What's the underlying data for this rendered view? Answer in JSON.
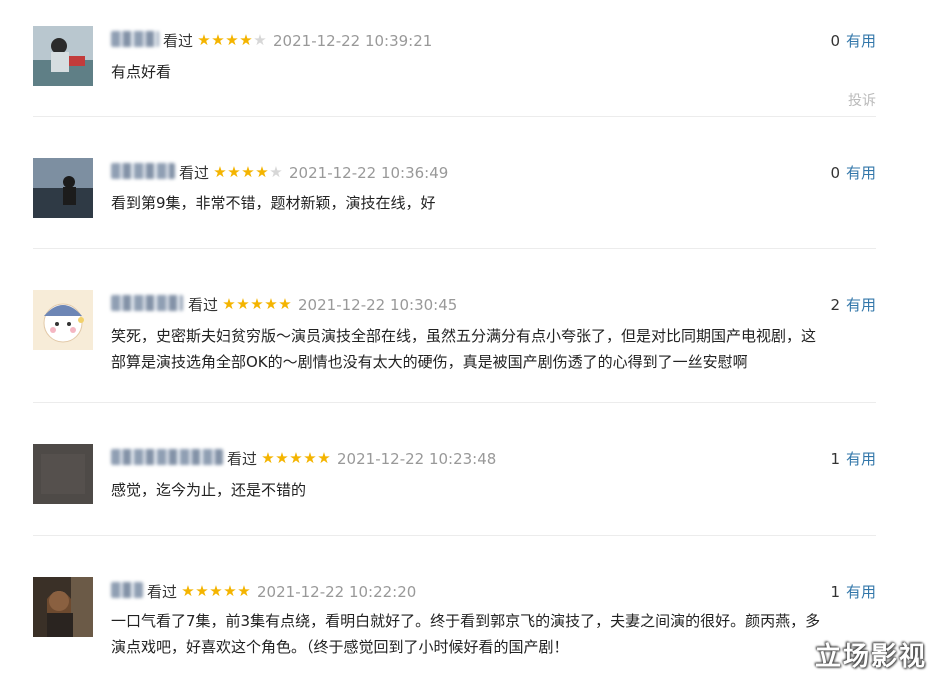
{
  "labels": {
    "watched": "看过",
    "useful": "有用",
    "report": "投诉"
  },
  "colors": {
    "star": "#f4b400",
    "useful_link": "#3377aa",
    "time": "#999999"
  },
  "comments": [
    {
      "name": "",
      "stars": 4,
      "time": "2021-12-22 10:39:21",
      "votes": "0",
      "text": "有点好看"
    },
    {
      "name": "",
      "stars": 4,
      "time": "2021-12-22 10:36:49",
      "votes": "0",
      "text": "看到第9集，非常不错，题材新颖，演技在线，好"
    },
    {
      "name": "",
      "stars": 5,
      "time": "2021-12-22 10:30:45",
      "votes": "2",
      "text_line1": "笑死，史密斯夫妇贫穷版～演员演技全部在线，虽然五分满分有点小夸张了，但是对比同期国产电视剧，这",
      "text_line2": "部算是演技选角全部OK的～剧情也没有太大的硬伤，真是被国产剧伤透了的心得到了一丝安慰啊"
    },
    {
      "name": "",
      "stars": 5,
      "time": "2021-12-22 10:23:48",
      "votes": "1",
      "text": "感觉，迄今为止，还是不错的"
    },
    {
      "name": "",
      "stars": 5,
      "time": "2021-12-22 10:22:20",
      "votes": "1",
      "text_line1": "一口气看了7集，前3集有点绕，看明白就好了。终于看到郭京飞的演技了，夫妻之间演的很好。颜丙燕，多",
      "text_line2": "演点戏吧，好喜欢这个角色。（终于感觉回到了小时候好看的国产剧！"
    }
  ],
  "watermark": "立场影视"
}
